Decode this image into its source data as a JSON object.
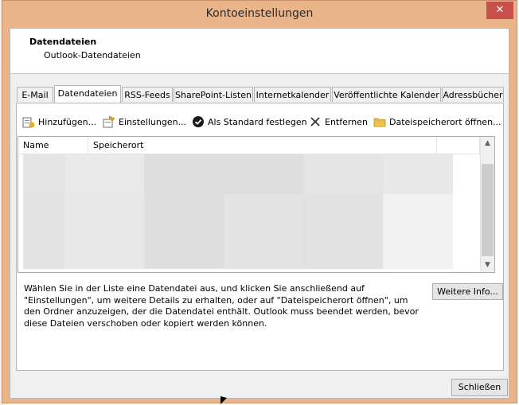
{
  "window": {
    "title": "Kontoeinstellungen",
    "close_label": "✕"
  },
  "header": {
    "title": "Datendateien",
    "subtitle": "Outlook-Datendateien"
  },
  "tabs": [
    {
      "label": "E-Mail",
      "active": false
    },
    {
      "label": "Datendateien",
      "active": true
    },
    {
      "label": "RSS-Feeds",
      "active": false
    },
    {
      "label": "SharePoint-Listen",
      "active": false
    },
    {
      "label": "Internetkalender",
      "active": false
    },
    {
      "label": "Veröffentlichte Kalender",
      "active": false
    },
    {
      "label": "Adressbücher",
      "active": false
    }
  ],
  "toolbar": {
    "add": "Hinzufügen...",
    "settings": "Einstellungen...",
    "default": "Als Standard festlegen",
    "remove": "Entfernen",
    "open_location": "Dateispeicherort öffnen..."
  },
  "list": {
    "columns": [
      "Name",
      "Speicherort"
    ],
    "rows_redacted": true
  },
  "description": "Wählen Sie in der Liste eine Datendatei aus, und klicken Sie anschließend auf \"Einstellungen\", um weitere Details zu erhalten, oder auf \"Dateispeicherort öffnen\", um den Ordner anzuzeigen, der die Datendatei enthält. Outlook muss beendet werden, bevor diese Dateien verschoben oder kopiert werden können.",
  "buttons": {
    "more_info": "Weitere Info...",
    "close": "Schließen"
  },
  "colors": {
    "frame": "#e9b48a",
    "close_button": "#c7504a",
    "redaction": "#e6e6e6"
  }
}
